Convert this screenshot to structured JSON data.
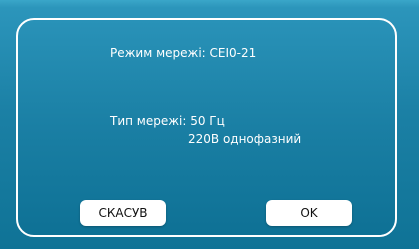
{
  "dialog": {
    "mode_line": "Режим мережі: CEI0-21",
    "type_line_1": "Тип мережі: 50 Гц",
    "type_line_2": "220В однофазний"
  },
  "buttons": {
    "cancel_label": "СКАСУВ",
    "ok_label": "OK"
  },
  "colors": {
    "background": "#1f88ad",
    "text": "#ffffff",
    "button_bg": "#ffffff",
    "button_text": "#111111"
  }
}
